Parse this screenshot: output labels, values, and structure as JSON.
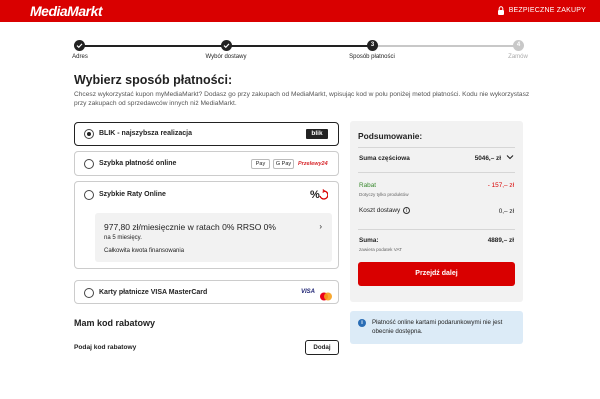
{
  "header": {
    "logo": "MediaMarkt",
    "secure_label": "BEZPIECZNE ZAKUPY",
    "brand_color": "#d90000"
  },
  "stepper": {
    "steps": [
      {
        "label": "Adres",
        "num": "",
        "state": "done"
      },
      {
        "label": "Wybór dostawy",
        "num": "",
        "state": "done"
      },
      {
        "label": "Sposób płatności",
        "num": "3",
        "state": "current"
      },
      {
        "label": "Zamów",
        "num": "4",
        "state": "inactive"
      }
    ]
  },
  "main": {
    "title": "Wybierz sposób płatności:",
    "intro": "Chcesz wykorzystać kupon myMediaMarkt? Dodasz go przy zakupach od MediaMarkt, wpisując kod w polu poniżej metod płatności. Kodu nie wykorzystasz przy zakupach od sprzedawców innych niż MediaMarkt.",
    "payments": [
      {
        "label": "BLIK - najszybsza realizacja",
        "selected": true,
        "logo": "blik"
      },
      {
        "label": "Szybka płatność online",
        "selected": false,
        "badges": [
          "Pay",
          "G Pay",
          "Przelewy24"
        ]
      },
      {
        "label": "Szybkie Raty Online",
        "selected": false,
        "icon": "percent-arrow-icon"
      },
      {
        "label": "Karty płatnicze VISA MasterCard",
        "selected": false,
        "badges": [
          "VISA",
          "mastercard"
        ]
      }
    ],
    "raty": {
      "main": "977,80 zł/miesięcznie w ratach 0% RRSO 0%",
      "sub": "na 5 miesięcy.",
      "financing": "Całkowita kwota finansowania"
    },
    "coupon": {
      "title": "Mam kod rabatowy",
      "label": "Podaj kod rabatowy",
      "button": "Dodaj"
    }
  },
  "summary": {
    "title": "Podsumowanie:",
    "subtotal_label": "Suma częściowa",
    "subtotal_value": "5046,– zł",
    "discount_label": "Rabat",
    "discount_note": "Dotyczy tylko produktów",
    "discount_value": "- 157,– zł",
    "shipping_label": "Koszt dostawy",
    "shipping_value": "0,– zł",
    "total_label": "Suma:",
    "total_note": "zawiera podatek VAT",
    "total_value": "4889,– zł",
    "cta": "Przejdź dalej"
  },
  "info": {
    "text": "Płatność online kartami podarunkowymi nie jest obecnie dostępna."
  }
}
